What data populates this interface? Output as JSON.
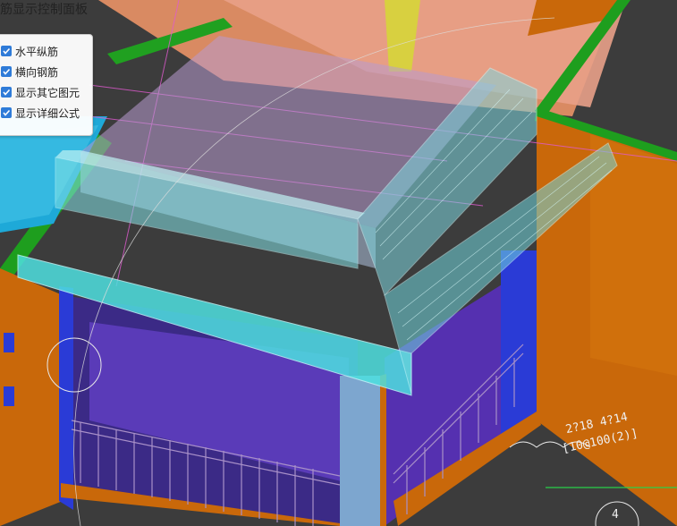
{
  "panel": {
    "title": "筋显示控制面板",
    "options": [
      {
        "label": "水平纵筋",
        "checked": true
      },
      {
        "label": "横向钢筋",
        "checked": true
      },
      {
        "label": "显示其它图元",
        "checked": true
      },
      {
        "label": "显示详细公式",
        "checked": true
      }
    ]
  },
  "annotations": {
    "rebar_a": "2?18 4?14",
    "rebar_b": "[10@100(2)]",
    "grid_number": "4"
  },
  "colors": {
    "background": "#3a3a3a",
    "beam_orange": "#c9680a",
    "wall_purple": "#5a2fa8",
    "column_blue": "#2a3bd6",
    "glass_cyan": "#7fe0e6",
    "accent_check": "#2f7bd8"
  }
}
